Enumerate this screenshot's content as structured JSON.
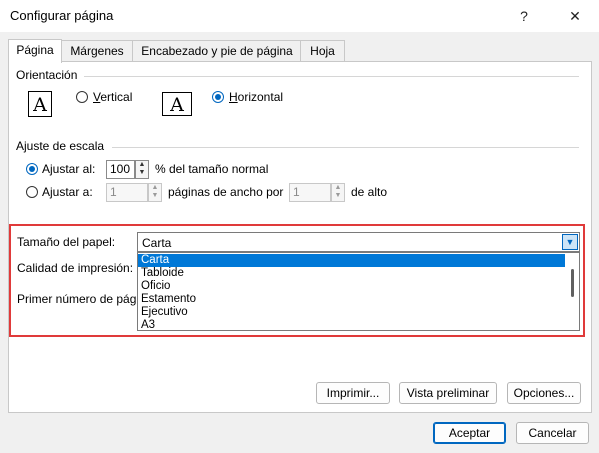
{
  "window": {
    "title": "Configurar página",
    "help_label": "?",
    "close_label": "✕"
  },
  "tabs": [
    {
      "label": "Página",
      "active": true
    },
    {
      "label": "Márgenes"
    },
    {
      "label": "Encabezado y pie de página"
    },
    {
      "label": "Hoja"
    }
  ],
  "orientation": {
    "group_label": "Orientación",
    "icon_glyph": "A",
    "vertical": {
      "label": "Vertical",
      "checked": false
    },
    "horizontal": {
      "label": "Horizontal",
      "checked": true
    }
  },
  "scaling": {
    "group_label": "Ajuste de escala",
    "adjust_to": {
      "label": "Ajustar al:",
      "checked": true,
      "value": "100",
      "suffix": "% del tamaño normal"
    },
    "fit_to": {
      "label": "Ajustar a:",
      "checked": false,
      "pages_wide": "1",
      "wide_suffix": "páginas de ancho por",
      "pages_tall": "1",
      "tall_suffix": "de alto"
    }
  },
  "paper_size": {
    "label": "Tamaño del papel:",
    "value": "Carta",
    "options": [
      "Carta",
      "Tabloide",
      "Oficio",
      "Estamento",
      "Ejecutivo",
      "A3"
    ],
    "selected_index": 0
  },
  "print_quality": {
    "label": "Calidad de impresión:"
  },
  "first_page": {
    "label": "Primer número de página:"
  },
  "buttons": {
    "print": "Imprimir...",
    "preview": "Vista preliminar",
    "options": "Opciones...",
    "accept": "Aceptar",
    "cancel": "Cancelar"
  },
  "colors": {
    "accent": "#0067c0",
    "highlight": "#e03a3a",
    "selection": "#0078d7"
  }
}
